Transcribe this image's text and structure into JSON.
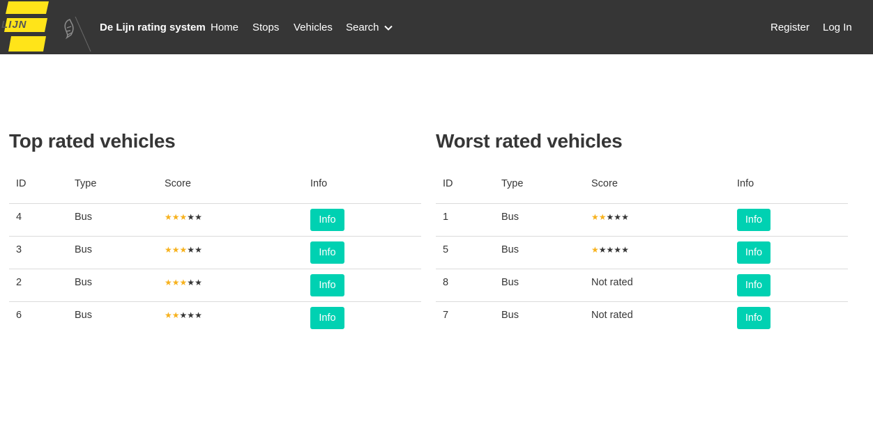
{
  "nav": {
    "logo_text": "LIJN",
    "brand": "De Lijn rating system",
    "items": [
      {
        "label": "Home"
      },
      {
        "label": "Stops"
      },
      {
        "label": "Vehicles"
      },
      {
        "label": "Search"
      }
    ],
    "register": "Register",
    "login": "Log In",
    "colors": {
      "bar": "#363636",
      "logo_yellow": "#ffe419"
    }
  },
  "top": {
    "title": "Top rated vehicles",
    "headers": {
      "id": "ID",
      "type": "Type",
      "score": "Score",
      "info": "Info"
    },
    "rows": [
      {
        "id": "4",
        "type": "Bus",
        "stars": 3,
        "info": "Info"
      },
      {
        "id": "3",
        "type": "Bus",
        "stars": 3,
        "info": "Info"
      },
      {
        "id": "2",
        "type": "Bus",
        "stars": 3,
        "info": "Info"
      },
      {
        "id": "6",
        "type": "Bus",
        "stars": 2,
        "info": "Info"
      }
    ]
  },
  "worst": {
    "title": "Worst rated vehicles",
    "headers": {
      "id": "ID",
      "type": "Type",
      "score": "Score",
      "info": "Info"
    },
    "rows": [
      {
        "id": "1",
        "type": "Bus",
        "stars": 2,
        "info": "Info"
      },
      {
        "id": "5",
        "type": "Bus",
        "stars": 1,
        "info": "Info"
      },
      {
        "id": "8",
        "type": "Bus",
        "score_text": "Not rated",
        "info": "Info"
      },
      {
        "id": "7",
        "type": "Bus",
        "score_text": "Not rated",
        "info": "Info"
      }
    ]
  },
  "star_max": 5,
  "colors": {
    "star_on": "#f7b21e",
    "star_off": "#363636",
    "button": "#00d1b2"
  }
}
